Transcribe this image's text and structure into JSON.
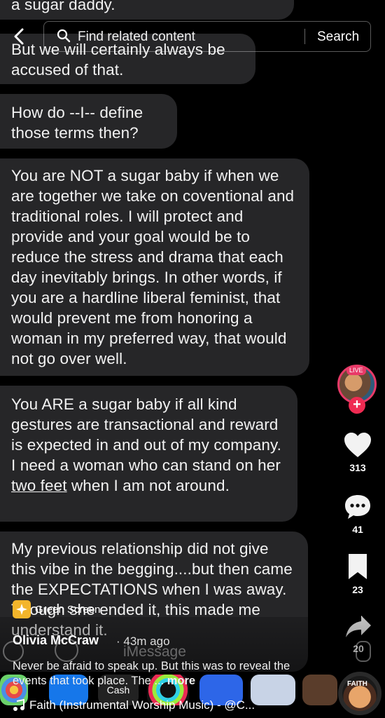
{
  "messages": [
    "a sugar daddy.",
    "But we will certainly always be accused of that.",
    "How do --I-- define those terms then?",
    "You are NOT a sugar baby if when we are together we take on coventional and traditional roles. I will protect and provide and your goal would be to reduce the stress and drama that each day inevitably brings. In other words, if you are a hardline liberal feminist, that would prevent me from honoring a woman in my preferred way, that would not go over well.",
    {
      "before": "You ARE a sugar baby if all kind gestures are transactional and reward is expected in and out of my company. I need a woman who can stand on her ",
      "link": "two feet",
      "after": " when I am not around."
    },
    "My previous relationship did not give this vibe in the begging....but then came the EXPECTATIONS when I was away. Though she ended it, this made me understand it."
  ],
  "search": {
    "placeholder": "Find related content",
    "button": "Search"
  },
  "rail": {
    "live_badge": "LIVE",
    "likes": "313",
    "comments": "41",
    "saves": "23",
    "shares": "20"
  },
  "post": {
    "effect_label": "Green Screen",
    "author": "Olivia McCraw",
    "time": "· 43m ago",
    "caption": "Never be afraid to speak up. But this was to reveal the events that took place. The ...",
    "more": "more",
    "music": "Faith (Instrumental Worship Music) - @C...",
    "music_disc_label": "FAITH"
  },
  "behind": {
    "imessage_placeholder": "iMessage",
    "cash_label": "Cash"
  },
  "colors": {
    "bubble": "#262628",
    "live": "#e83a68",
    "like_plus": "#ef2b52",
    "effect_icon": "#f3b52b"
  }
}
